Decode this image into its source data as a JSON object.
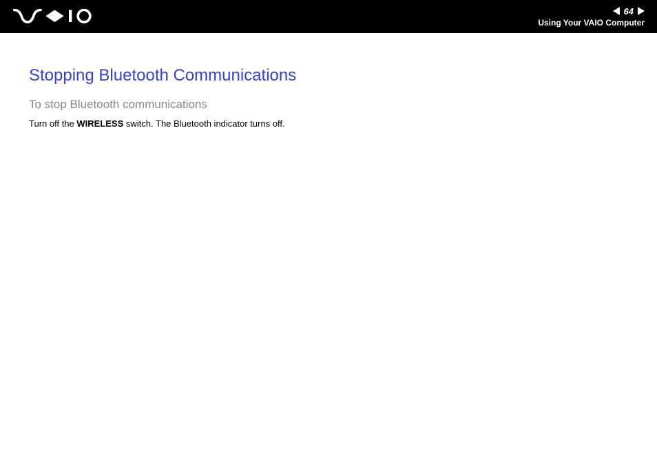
{
  "header": {
    "page_number": "64",
    "section_name": "Using Your VAIO Computer"
  },
  "content": {
    "title": "Stopping Bluetooth Communications",
    "subtitle": "To stop Bluetooth communications",
    "body_pre": "Turn off the ",
    "body_bold": "WIRELESS",
    "body_post": " switch. The Bluetooth indicator turns off."
  }
}
